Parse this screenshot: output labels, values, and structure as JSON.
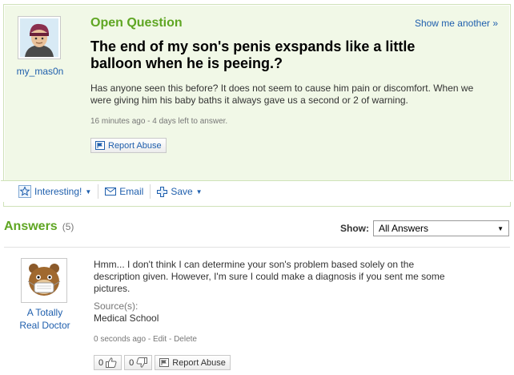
{
  "question": {
    "type_label": "Open Question",
    "show_another": "Show me another »",
    "asker": "my_mas0n",
    "title": "The end of my son's penis exspands like a little balloon when he is peeing.?",
    "detail": "Has anyone seen this before? It does not seem to cause him pain or discomfort. When we were giving him his baby baths it always gave us a second or 2 of warning.",
    "meta": "16 minutes ago - 4 days left to answer.",
    "report_label": "Report Abuse"
  },
  "actions": {
    "interesting": "Interesting!",
    "email": "Email",
    "save": "Save"
  },
  "answers_header": {
    "title": "Answers",
    "count": "(5)",
    "show_label": "Show:",
    "selected": "All Answers"
  },
  "answer": {
    "author_line1": "A Totally",
    "author_line2": "Real Doctor",
    "body": "Hmm... I don't think I can determine your son's problem based solely on the description given. However, I'm sure I could make a diagnosis if you sent me some pictures.",
    "source_label": "Source(s):",
    "source": "Medical School",
    "time": "0 seconds ago",
    "edit": "Edit",
    "delete": "Delete",
    "thumbs_up": "0",
    "thumbs_down": "0",
    "report_label": "Report Abuse"
  },
  "colors": {
    "accent_green": "#5fa623",
    "link_blue": "#1f5fad",
    "question_bg": "#f1f8e7"
  }
}
